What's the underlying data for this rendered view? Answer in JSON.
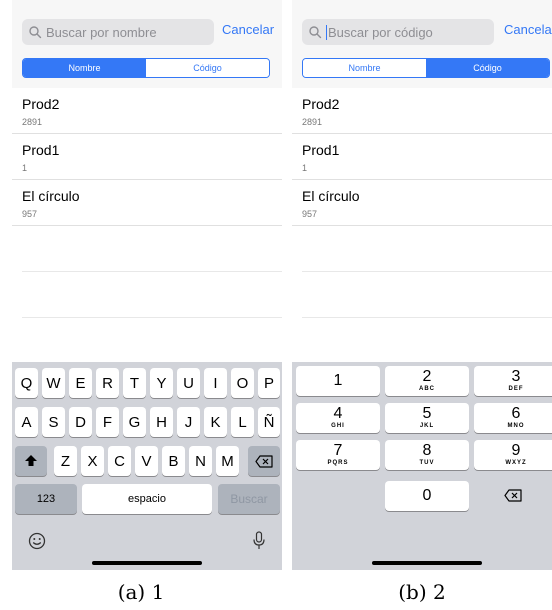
{
  "panel_a": {
    "search": {
      "placeholder": "Buscar por nombre",
      "cancel_label": "Cancelar"
    },
    "segmented": {
      "options": [
        "Nombre",
        "Código"
      ],
      "selected": "Nombre"
    },
    "rows": [
      {
        "name": "Prod2",
        "code": "2891"
      },
      {
        "name": "Prod1",
        "code": "1"
      },
      {
        "name": "El círculo",
        "code": "957"
      }
    ],
    "keyboard": {
      "row1": [
        "Q",
        "W",
        "E",
        "R",
        "T",
        "Y",
        "U",
        "I",
        "O",
        "P"
      ],
      "row2": [
        "A",
        "S",
        "D",
        "F",
        "G",
        "H",
        "J",
        "K",
        "L",
        "Ñ"
      ],
      "row3": [
        "Z",
        "X",
        "C",
        "V",
        "B",
        "N",
        "M"
      ],
      "numbers_label": "123",
      "space_label": "espacio",
      "search_label": "Buscar"
    },
    "caption": "(a) 1"
  },
  "panel_b": {
    "search": {
      "placeholder": "Buscar por código",
      "cancel_label": "Cancelar"
    },
    "segmented": {
      "options": [
        "Nombre",
        "Código"
      ],
      "selected": "Código"
    },
    "rows": [
      {
        "name": "Prod2",
        "code": "2891"
      },
      {
        "name": "Prod1",
        "code": "1"
      },
      {
        "name": "El círculo",
        "code": "957"
      }
    ],
    "keypad": [
      {
        "digit": "1",
        "letters": ""
      },
      {
        "digit": "2",
        "letters": "ABC"
      },
      {
        "digit": "3",
        "letters": "DEF"
      },
      {
        "digit": "4",
        "letters": "GHI"
      },
      {
        "digit": "5",
        "letters": "JKL"
      },
      {
        "digit": "6",
        "letters": "MNO"
      },
      {
        "digit": "7",
        "letters": "PQRS"
      },
      {
        "digit": "8",
        "letters": "TUV"
      },
      {
        "digit": "9",
        "letters": "WXYZ"
      },
      {
        "digit": "0",
        "letters": ""
      }
    ],
    "caption": "(b) 2"
  },
  "colors": {
    "accent": "#3478f6",
    "keyboard_bg": "#d1d3d9",
    "header_bg": "#f7f7f7"
  }
}
